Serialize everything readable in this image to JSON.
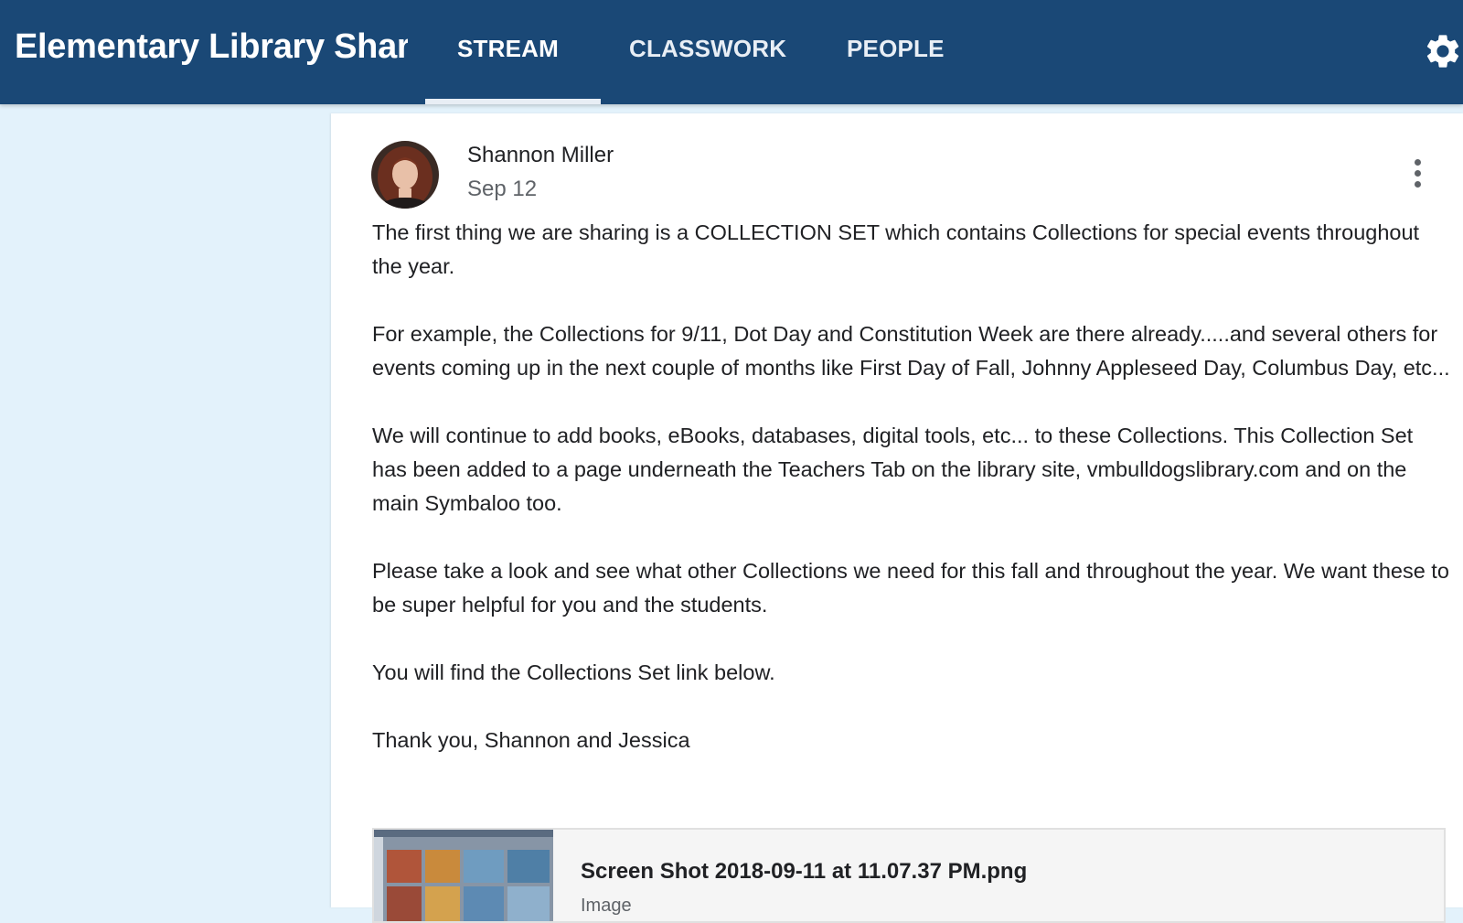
{
  "header": {
    "class_title": "Elementary Library Shar...",
    "tabs": [
      {
        "label": "STREAM",
        "active": true
      },
      {
        "label": "CLASSWORK",
        "active": false
      },
      {
        "label": "PEOPLE",
        "active": false
      }
    ],
    "settings_icon": "gear-icon"
  },
  "post": {
    "author": "Shannon Miller",
    "date": "Sep 12",
    "menu_icon": "more-vertical-icon",
    "paragraphs": [
      "The first thing we are sharing is a COLLECTION SET which contains Collections for special events throughout the year.",
      "For example, the Collections for 9/11, Dot Day and Constitution Week are there already.....and several others for events coming up in the next couple of months like First Day of Fall, Johnny Appleseed Day, Columbus Day, etc...",
      "We will continue to add books, eBooks, databases, digital tools, etc... to these Collections. This Collection Set has been added to a page underneath the Teachers Tab on the library site, vmbulldogslibrary.com and on the main Symbaloo too.",
      "Please take a look and see what other Collections we need for this fall and throughout the year. We want these to be super helpful for you and the students.",
      "You will find the Collections Set link below.",
      "Thank you, Shannon and Jessica"
    ],
    "attachment": {
      "name": "Screen Shot 2018-09-11 at 11.07.37 PM.png",
      "type": "Image"
    }
  },
  "colors": {
    "header_bg": "#1a4876",
    "page_bg": "#e3f2fb",
    "card_bg": "#ffffff"
  }
}
